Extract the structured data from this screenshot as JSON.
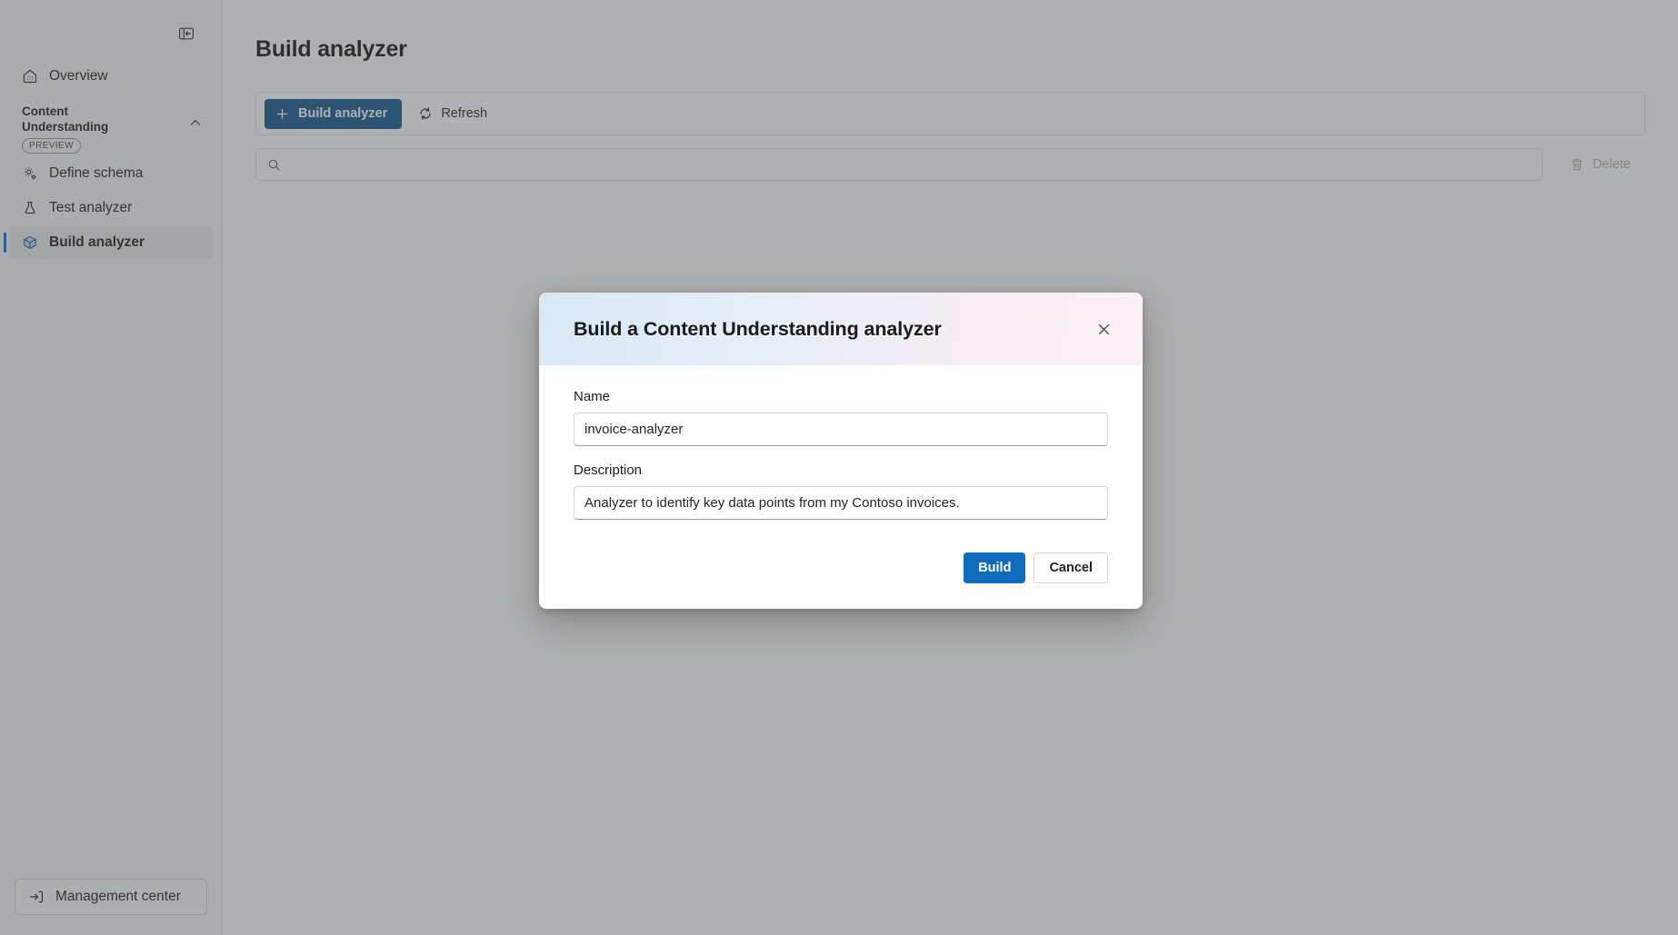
{
  "sidebar": {
    "collapse_button": {
      "tooltip": "Collapse navigation",
      "icon": "panel-collapse-icon"
    },
    "overview": {
      "label": "Overview",
      "icon": "home-icon"
    },
    "group": {
      "label_line1": "Content",
      "label_line2": "Understanding",
      "badge": "PREVIEW",
      "chevron": "chevron-up-icon"
    },
    "items": [
      {
        "label": "Define schema",
        "icon": "schema-gears-icon",
        "selected": false
      },
      {
        "label": "Test analyzer",
        "icon": "beaker-icon",
        "selected": false
      },
      {
        "label": "Build analyzer",
        "icon": "cube-icon",
        "selected": true
      }
    ],
    "management_center": {
      "label": "Management center",
      "icon": "sign-in-arrow-icon"
    }
  },
  "main": {
    "page_title": "Build analyzer",
    "command_bar": {
      "build_button": {
        "label": "Build analyzer",
        "icon": "plus-icon"
      },
      "refresh_button": {
        "label": "Refresh",
        "icon": "refresh-icon"
      }
    },
    "search": {
      "value": "",
      "placeholder": "",
      "icon": "search-icon"
    },
    "delete_button": {
      "label": "Delete",
      "icon": "trash-icon",
      "disabled": true
    }
  },
  "dialog": {
    "title": "Build a Content Understanding analyzer",
    "close_icon": "close-icon",
    "fields": [
      {
        "label": "Name",
        "value": "invoice-analyzer",
        "placeholder": ""
      },
      {
        "label": "Description",
        "value": "Analyzer to identify key data points from my Contoso invoices.",
        "placeholder": ""
      }
    ],
    "primary_button": "Build",
    "secondary_button": "Cancel"
  },
  "colors": {
    "accent_blue": "#0f6cbd",
    "dark_blue": "#0f548c",
    "sidebar_bg": "#f7f7f7",
    "selected_item_bg": "#ebebeb",
    "dialog_header_from": "#d7e8f5",
    "dialog_header_to": "#fbf0f6",
    "overlay": "rgba(80,82,86,0.46)"
  }
}
